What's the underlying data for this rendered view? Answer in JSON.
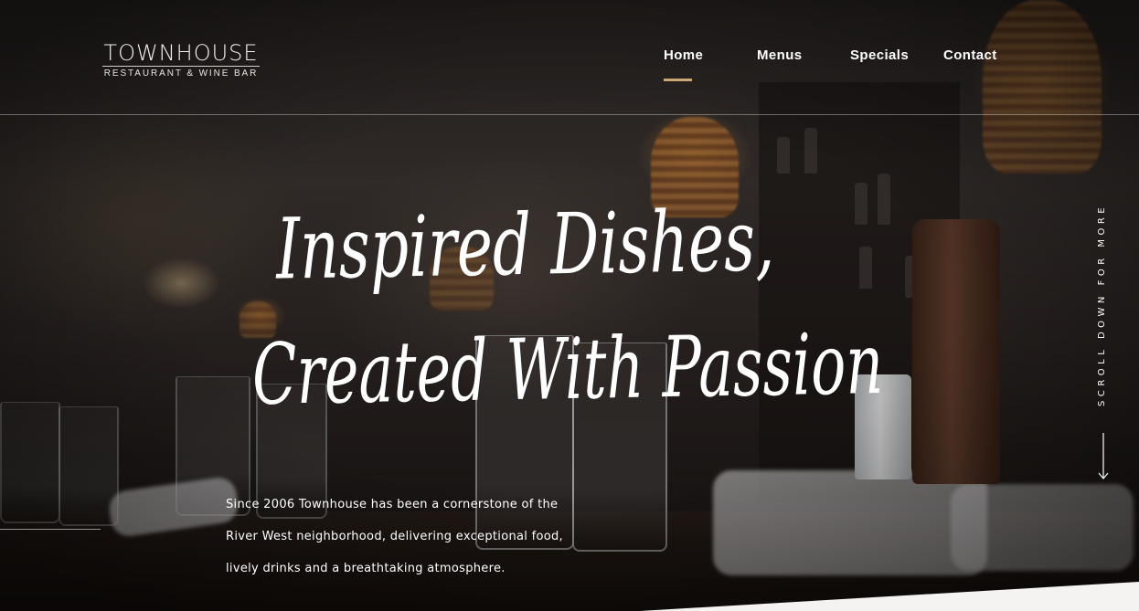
{
  "brand": {
    "name": "TOWNHOUSE",
    "tagline": "RESTAURANT & WINE BAR"
  },
  "nav": {
    "items": [
      {
        "label": "Home",
        "active": true
      },
      {
        "label": "Menus",
        "active": false
      },
      {
        "label": "Specials",
        "active": false
      },
      {
        "label": "Contact",
        "active": false
      }
    ]
  },
  "hero": {
    "headline_line1": "Inspired Dishes,",
    "headline_line2": "Created With Passion",
    "description_lines": [
      "Since 2006 Townhouse has been a cornerstone of the",
      "River West neighborhood, delivering exceptional food,",
      "lively drinks and a breathtaking atmosphere."
    ],
    "scroll_label": "SCROLL DOWN FOR MORE",
    "scroll_icon": "arrow-down-icon"
  },
  "colors": {
    "accent": "#c9a978",
    "text": "#ffffff",
    "divider": "rgba(255,255,255,0.35)"
  }
}
